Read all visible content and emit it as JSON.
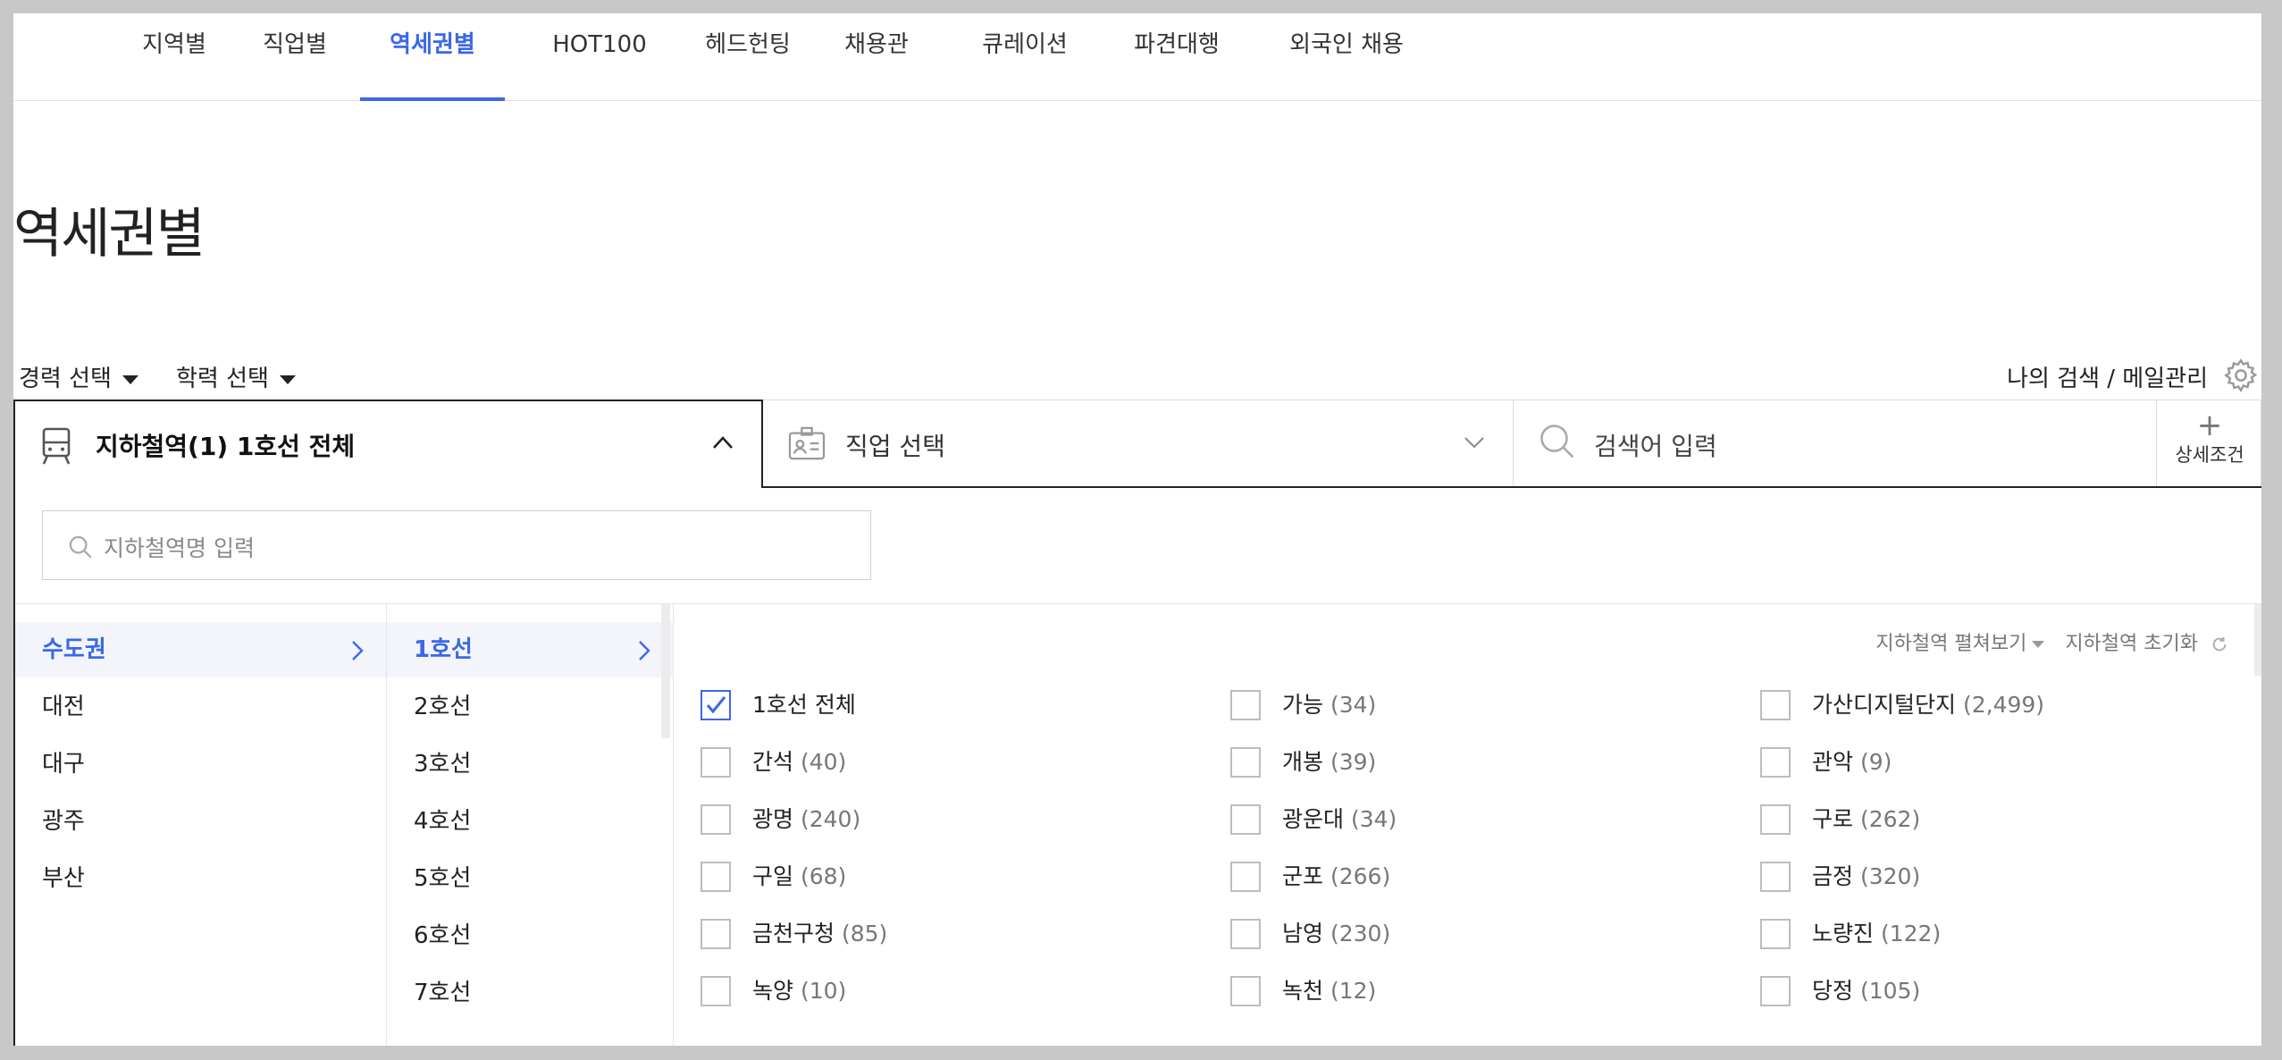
{
  "nav": {
    "tabs": [
      {
        "label": "지역별",
        "active": false
      },
      {
        "label": "직업별",
        "active": false
      },
      {
        "label": "역세권별",
        "active": true
      },
      {
        "label": "HOT100",
        "active": false
      },
      {
        "label": "헤드헌팅",
        "active": false
      },
      {
        "label": "채용관",
        "active": false
      },
      {
        "label": "큐레이션",
        "active": false
      },
      {
        "label": "파견대행",
        "active": false
      },
      {
        "label": "외국인 채용",
        "active": false
      }
    ]
  },
  "page_title": "역세권별",
  "filters": {
    "career": "경력 선택",
    "education": "학력 선택",
    "my_search": "나의 검색 / 메일관리"
  },
  "search_bar": {
    "station": "지하철역(1) 1호선 전체",
    "job": "직업 선택",
    "keyword_placeholder": "검색어 입력",
    "advanced": "상세조건"
  },
  "panel": {
    "search_placeholder": "지하철역명 입력",
    "regions": [
      "수도권",
      "대전",
      "대구",
      "광주",
      "부산"
    ],
    "selected_region": "수도권",
    "lines": [
      "1호선",
      "2호선",
      "3호선",
      "4호선",
      "5호선",
      "6호선",
      "7호선"
    ],
    "selected_line": "1호선",
    "tools": {
      "expand": "지하철역 펼쳐보기",
      "reset": "지하철역 초기화"
    },
    "stations": [
      {
        "name": "1호선 전체",
        "count": "",
        "checked": true
      },
      {
        "name": "가능",
        "count": "(34)",
        "checked": false
      },
      {
        "name": "가산디지털단지",
        "count": "(2,499)",
        "checked": false
      },
      {
        "name": "간석",
        "count": "(40)",
        "checked": false
      },
      {
        "name": "개봉",
        "count": "(39)",
        "checked": false
      },
      {
        "name": "관악",
        "count": "(9)",
        "checked": false
      },
      {
        "name": "광명",
        "count": "(240)",
        "checked": false
      },
      {
        "name": "광운대",
        "count": "(34)",
        "checked": false
      },
      {
        "name": "구로",
        "count": "(262)",
        "checked": false
      },
      {
        "name": "구일",
        "count": "(68)",
        "checked": false
      },
      {
        "name": "군포",
        "count": "(266)",
        "checked": false
      },
      {
        "name": "금정",
        "count": "(320)",
        "checked": false
      },
      {
        "name": "금천구청",
        "count": "(85)",
        "checked": false
      },
      {
        "name": "남영",
        "count": "(230)",
        "checked": false
      },
      {
        "name": "노량진",
        "count": "(122)",
        "checked": false
      },
      {
        "name": "녹양",
        "count": "(10)",
        "checked": false
      },
      {
        "name": "녹천",
        "count": "(12)",
        "checked": false
      },
      {
        "name": "당정",
        "count": "(105)",
        "checked": false
      }
    ]
  },
  "colors": {
    "accent": "#3b68e8",
    "text": "#222222",
    "border": "#dcdcdc"
  }
}
